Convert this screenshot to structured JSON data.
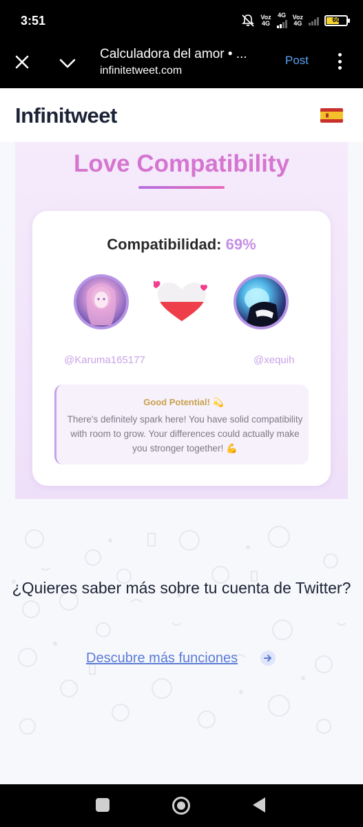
{
  "status_bar": {
    "time": "3:51",
    "sim1_label": "Voz",
    "sim1_net": "4G",
    "sim2_top": "4G",
    "sim2_label": "Voz",
    "sim2_net": "4G",
    "battery": "60",
    "battery_level": 0.6
  },
  "browser": {
    "title": "Calculadora del amor • ...",
    "url": "infinitetweet.com",
    "action": "Post"
  },
  "site": {
    "logo": "Infinitweet",
    "flag_icon": "spain-flag-icon"
  },
  "love": {
    "title": "Love Compatibility",
    "compat_label": "Compatibilidad:",
    "compat_value": "69%",
    "user1": "@Karuma165177",
    "user2": "@xequih",
    "message_title": "Good Potential! 💫",
    "message_body": "There's definitely spark here! You have solid compatibility with room to grow. Your differences could actually make you stronger together! 💪",
    "heart_fill": 0.5
  },
  "cta": {
    "question": "¿Quieres saber más sobre tu cuenta de Twitter?",
    "link": "Descubre más funciones"
  },
  "colors": {
    "accent": "#d575d0",
    "pct": "#c58fe6",
    "link": "#5b7bd8",
    "heart": "#ee3e4a",
    "post": "#5aa3f0"
  }
}
